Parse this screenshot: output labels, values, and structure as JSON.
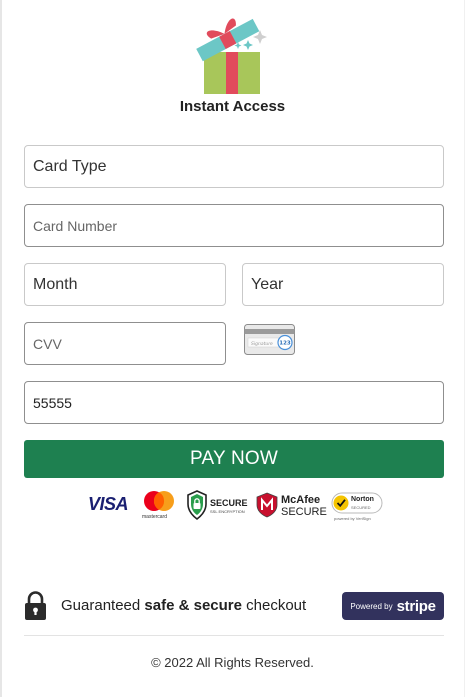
{
  "header": {
    "title": "Instant Access"
  },
  "form": {
    "card_type": "Card Type",
    "card_number_placeholder": "Card Number",
    "month": "Month",
    "year": "Year",
    "cvv_placeholder": "CVV",
    "zip_value": "55555",
    "cvv_hint_text": "Signature",
    "cvv_hint_number": "123"
  },
  "pay_button": {
    "label": "PAY NOW",
    "color": "#1e8050"
  },
  "trust_badges": {
    "visa": "VISA",
    "mastercard": "mastercard",
    "secure": "SECURE",
    "secure_sub": "SSL ENCRYPTION",
    "mcafee_top": "McAfee",
    "mcafee_bottom": "SECURE",
    "norton": "Norton",
    "norton_secured": "SECURED",
    "norton_sub": "powered by VeriSign"
  },
  "guarantee": {
    "prefix": "Guaranteed ",
    "bold": "safe & secure",
    "suffix": " checkout"
  },
  "stripe_badge": {
    "powered_by": "Powered by",
    "brand": "stripe"
  },
  "footer": {
    "copyright": "© 2022 All Rights Reserved."
  },
  "colors": {
    "accent": "#1e8050",
    "stripe": "#32325d",
    "visa": "#1a1f71"
  }
}
